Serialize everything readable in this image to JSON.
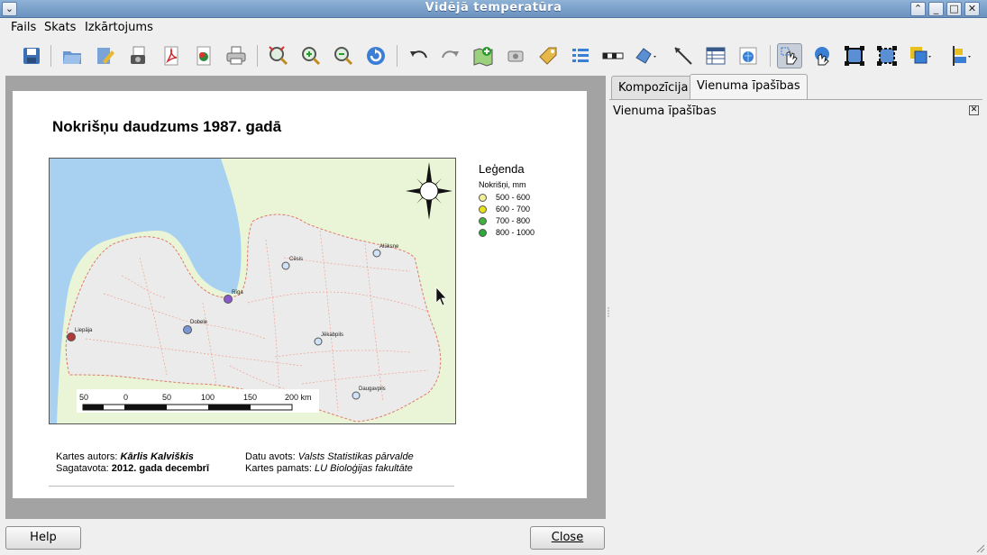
{
  "window": {
    "title": "Vidējā temperatūra"
  },
  "menu": {
    "items": [
      "Fails",
      "Skats",
      "Izkārtojums"
    ]
  },
  "map": {
    "title": "Nokrišņu daudzums 1987. gadā",
    "cities": [
      "Liepāja",
      "Dobele",
      "Rīga",
      "Cēsis",
      "Alūksne",
      "Jēkabpils",
      "Daugavpils"
    ],
    "scalebar": {
      "labels": [
        "50",
        "0",
        "50",
        "100",
        "150",
        "200 km"
      ]
    },
    "legend": {
      "title": "Leģenda",
      "subtitle": "Nokrišņi, mm",
      "entries": [
        {
          "label": "500 - 600",
          "color": "#f2ee9a"
        },
        {
          "label": "600 - 700",
          "color": "#e8e21a"
        },
        {
          "label": "700 - 800",
          "color": "#41b041"
        },
        {
          "label": "800 - 1000",
          "color": "#2ea83a"
        }
      ]
    },
    "footer": {
      "author_label": "Kartes autors:",
      "author": "Kārlis Kalviškis",
      "prepared_label": "Sagatavota:",
      "prepared": "2012. gada decembrī",
      "source_label": "Datu avots:",
      "source": "Valsts Statistikas pārvalde",
      "base_label": "Kartes pamats:",
      "base": "LU Bioloģijas fakultāte"
    }
  },
  "panel": {
    "tabs": [
      "Kompozīcija",
      "Vienuma īpašības"
    ],
    "active_tab": "Vienuma īpašības",
    "title": "Vienuma īpašības"
  },
  "buttons": {
    "help": "Help",
    "close": "Close"
  },
  "colors": {
    "titlebar": "#7a9fc9",
    "water": "#a8d0f0",
    "land": "#e9f5d6",
    "latvia": "#ebebeb",
    "borders": "#f0a090"
  }
}
